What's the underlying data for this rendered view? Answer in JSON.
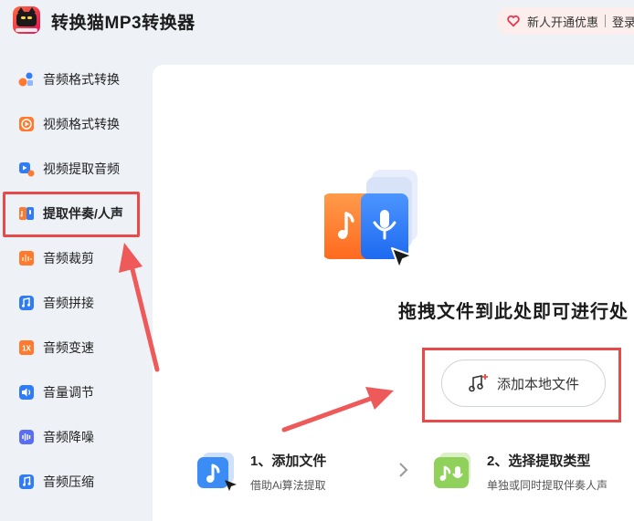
{
  "app": {
    "title": "转换猫MP3转换器"
  },
  "promo": {
    "offer": "新人开通优惠",
    "login": "登录/"
  },
  "sidebar": {
    "items": [
      {
        "label": "音频格式转换",
        "icon": "audio-format-icon"
      },
      {
        "label": "视频格式转换",
        "icon": "video-format-icon"
      },
      {
        "label": "视频提取音频",
        "icon": "video-extract-audio-icon"
      },
      {
        "label": "提取伴奏/人声",
        "icon": "extract-vocal-icon",
        "active": true
      },
      {
        "label": "音频裁剪",
        "icon": "audio-cut-icon"
      },
      {
        "label": "音频拼接",
        "icon": "audio-merge-icon"
      },
      {
        "label": "音频变速",
        "icon": "audio-speed-icon",
        "badge": "1X"
      },
      {
        "label": "音量调节",
        "icon": "volume-icon"
      },
      {
        "label": "音频降噪",
        "icon": "denoise-icon"
      },
      {
        "label": "音频压缩",
        "icon": "audio-compress-icon"
      }
    ]
  },
  "main": {
    "drop_text": "拖拽文件到此处即可进行处",
    "add_button": "添加本地文件",
    "steps": [
      {
        "title": "1、添加文件",
        "desc": "借助Ai算法提取"
      },
      {
        "title": "2、选择提取类型",
        "desc": "单独或同时提取伴奏人声"
      }
    ]
  },
  "colors": {
    "accent_red": "#e84a4a",
    "brand_blue": "#2f7cf6",
    "brand_orange": "#ff7a2f",
    "bg": "#eef1f6"
  }
}
